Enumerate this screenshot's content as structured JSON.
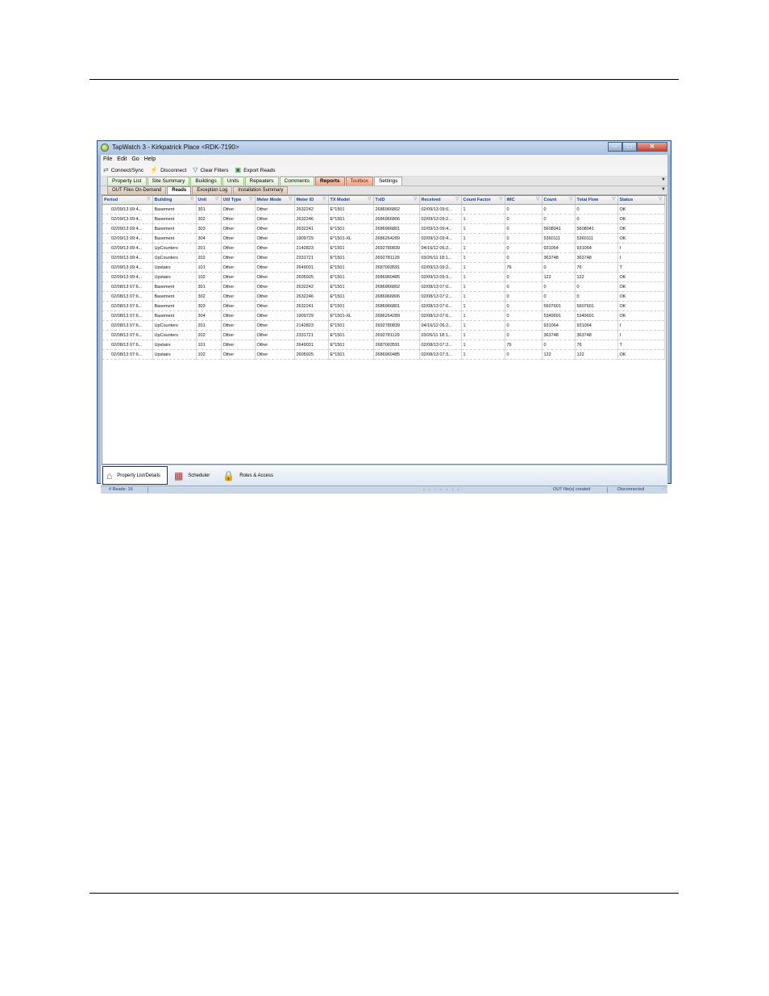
{
  "window": {
    "title": "TapWatch 3 - Kirkpatrick Place <RDK-7190>",
    "controls": {
      "minimize": "–",
      "maximize": "□",
      "close": "✕"
    }
  },
  "menu": [
    "File",
    "Edit",
    "Go",
    "Help"
  ],
  "toolbar": {
    "connect_sync": "Connect/Sync",
    "disconnect": "Disconnect",
    "clear_filters": "Clear Filters",
    "export_reads": "Export Reads"
  },
  "main_tabs": [
    "Property List",
    "Site Summary",
    "Buildings",
    "Units",
    "Repeaters",
    "Comments",
    "Reports",
    "Toolbox",
    "Settings"
  ],
  "sub_tabs": [
    "OUT Files On-Demand",
    "Reads",
    "Exception Log",
    "Installation Summary"
  ],
  "grid": {
    "columns": [
      "Period",
      "Building",
      "Unit",
      "Util Type",
      "Meter Mode",
      "Meter ID",
      "TX Model",
      "TxID",
      "Received",
      "Count Factor",
      "IMC",
      "Count",
      "Total Flow",
      "Status"
    ],
    "rows": [
      [
        "02/09/13  09:4...",
        "Basement",
        "301",
        "Other",
        "Other",
        "2632242",
        "E*1501",
        "2686966802",
        "02/09/13  09:0...",
        "1",
        "0",
        "0",
        "0",
        "OK"
      ],
      [
        "02/09/13  09:4...",
        "Basement",
        "302",
        "Other",
        "Other",
        "2632246",
        "E*1501",
        "2686966806",
        "02/09/13  09:2...",
        "1",
        "0",
        "0",
        "0",
        "OK"
      ],
      [
        "02/09/13  09:4...",
        "Basement",
        "303",
        "Other",
        "Other",
        "2632241",
        "E*1501",
        "2686966801",
        "02/09/13  09:4...",
        "1",
        "0",
        "5608041",
        "5608041",
        "OK"
      ],
      [
        "02/09/13  09:4...",
        "Basement",
        "304",
        "Other",
        "Other",
        "1909729",
        "E*1501-XL",
        "2686264289",
        "02/09/13  09:4...",
        "1",
        "0",
        "5360111",
        "5360111",
        "OK"
      ],
      [
        "02/09/13  09:4...",
        "UpCounters",
        "201",
        "Other",
        "Other",
        "2142823",
        "E*1501",
        "2692780839",
        "04/16/12  06:2...",
        "1",
        "0",
        "931064",
        "931064",
        "I"
      ],
      [
        "02/09/13  09:4...",
        "UpCounters",
        "202",
        "Other",
        "Other",
        "2331721",
        "E*1501",
        "2692781129",
        "03/26/11  18:1...",
        "1",
        "0",
        "363748",
        "363748",
        "I"
      ],
      [
        "02/09/13  09:4...",
        "Upstairs",
        "101",
        "Other",
        "Other",
        "2649031",
        "E*1501",
        "2687003591",
        "02/09/13  09:2...",
        "1",
        "76",
        "0",
        "76",
        "T"
      ],
      [
        "02/09/13  09:4...",
        "Upstairs",
        "102",
        "Other",
        "Other",
        "2605925",
        "E*1501",
        "2686960485",
        "02/09/13  09:3...",
        "1",
        "0",
        "122",
        "122",
        "OK"
      ],
      [
        "02/08/13  07:6...",
        "Basement",
        "301",
        "Other",
        "Other",
        "2632242",
        "E*1501",
        "2686966802",
        "02/08/13  07:0...",
        "1",
        "0",
        "0",
        "0",
        "OK"
      ],
      [
        "02/08/13  07:6...",
        "Basement",
        "302",
        "Other",
        "Other",
        "2632246",
        "E*1501",
        "2686966806",
        "02/08/13  07:2...",
        "1",
        "0",
        "0",
        "0",
        "OK"
      ],
      [
        "02/08/13  07:6...",
        "Basement",
        "303",
        "Other",
        "Other",
        "2632241",
        "E*1501",
        "2686966801",
        "02/08/13  07:6...",
        "1",
        "0",
        "5607601",
        "5607601",
        "OK"
      ],
      [
        "02/08/13  07:6...",
        "Basement",
        "304",
        "Other",
        "Other",
        "1909729",
        "E*1501-XL",
        "2686264289",
        "02/08/13  07:6...",
        "1",
        "0",
        "5349691",
        "5349691",
        "OK"
      ],
      [
        "02/08/13  07:6...",
        "UpCounters",
        "201",
        "Other",
        "Other",
        "2142823",
        "E*1501",
        "2692780839",
        "04/16/12  06:2...",
        "1",
        "0",
        "931064",
        "931064",
        "I"
      ],
      [
        "02/08/13  07:6...",
        "UpCounters",
        "202",
        "Other",
        "Other",
        "2331721",
        "E*1501",
        "2692781129",
        "03/26/11  18:1...",
        "1",
        "0",
        "363748",
        "363748",
        "I"
      ],
      [
        "02/08/13  07:6...",
        "Upstairs",
        "101",
        "Other",
        "Other",
        "2649031",
        "E*1501",
        "2687003591",
        "02/08/13  07:2...",
        "1",
        "76",
        "0",
        "76",
        "T"
      ],
      [
        "02/08/13  07:6...",
        "Upstairs",
        "102",
        "Other",
        "Other",
        "2605925",
        "E*1501",
        "2686960485",
        "02/08/13  07:3...",
        "1",
        "0",
        "122",
        "122",
        "OK"
      ]
    ]
  },
  "bottom_nav": {
    "property": "Property List/Details",
    "scheduler": "Scheduler",
    "roles": "Roles & Access"
  },
  "status": {
    "reads": "# Reads: 16",
    "message": "OUT file(s) created",
    "connection": "Disconnected"
  }
}
